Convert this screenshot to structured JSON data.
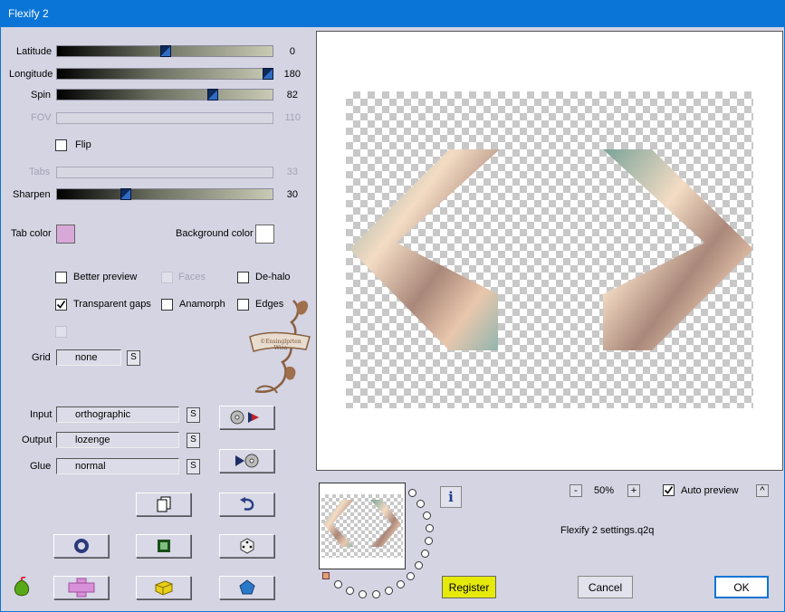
{
  "window": {
    "title": "Flexify 2"
  },
  "sliders": [
    {
      "id": "latitude",
      "label": "Latitude",
      "value": "0",
      "fraction": 0.5,
      "enabled": true
    },
    {
      "id": "longitude",
      "label": "Longitude",
      "value": "180",
      "fraction": 1.0,
      "enabled": true
    },
    {
      "id": "spin",
      "label": "Spin",
      "value": "82",
      "fraction": 0.72,
      "enabled": true
    },
    {
      "id": "fov",
      "label": "FOV",
      "value": "110",
      "fraction": 0,
      "enabled": false
    },
    {
      "id": "tabs",
      "label": "Tabs",
      "value": "33",
      "fraction": 0,
      "enabled": false
    },
    {
      "id": "sharpen",
      "label": "Sharpen",
      "value": "30",
      "fraction": 0.31,
      "enabled": true
    }
  ],
  "flip": {
    "label": "Flip",
    "checked": false
  },
  "colors": {
    "tab_color_label": "Tab color",
    "tab_color": "#d8a8d8",
    "background_color_label": "Background color",
    "background_color": "#ffffff"
  },
  "options": {
    "better_preview": {
      "label": "Better preview",
      "checked": false
    },
    "faces": {
      "label": "Faces",
      "checked": false,
      "enabled": false
    },
    "de_halo": {
      "label": "De-halo",
      "checked": false
    },
    "transparent_gaps": {
      "label": "Transparent gaps",
      "checked": true
    },
    "anamorph": {
      "label": "Anamorph",
      "checked": false
    },
    "edges": {
      "label": "Edges",
      "checked": false
    }
  },
  "grid": {
    "label": "Grid",
    "value": "none",
    "s_label": "S"
  },
  "input": {
    "label": "Input",
    "value": "orthographic",
    "s_label": "S"
  },
  "output": {
    "label": "Output",
    "value": "lozenge",
    "s_label": "S"
  },
  "glue": {
    "label": "Glue",
    "value": "normal",
    "s_label": "S"
  },
  "zoom": {
    "minus": "-",
    "value": "50%",
    "plus": "+"
  },
  "auto_preview": {
    "label": "Auto preview",
    "checked": true,
    "toggle": "^"
  },
  "settings_file": "Flexify 2 settings.q2q",
  "info_label": "i",
  "buttons": {
    "register": "Register",
    "cancel": "Cancel",
    "ok": "OK"
  },
  "watermark_text": "©Ensinglprten Wisa",
  "accent_colors": {
    "title_bar": "#0a75d6",
    "register": "#e6ea0a"
  }
}
